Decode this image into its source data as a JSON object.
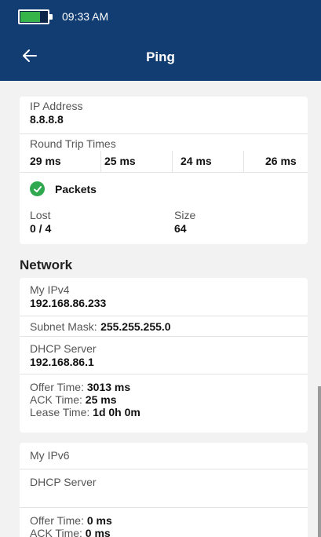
{
  "status_bar": {
    "time": "09:33 AM"
  },
  "header": {
    "title": "Ping"
  },
  "ping": {
    "ip_label": "IP Address",
    "ip_value": "8.8.8.8",
    "rtt_label": "Round Trip Times",
    "rtt": [
      "29 ms",
      "25 ms",
      "24 ms",
      "26 ms"
    ],
    "packets_label": "Packets",
    "lost_label": "Lost",
    "lost_value": "0 / 4",
    "size_label": "Size",
    "size_value": "64"
  },
  "network": {
    "section_title": "Network",
    "ipv4_label": "My IPv4",
    "ipv4_value": "192.168.86.233",
    "subnet_label": "Subnet Mask:",
    "subnet_value": "255.255.255.0",
    "dhcp_label": "DHCP Server",
    "dhcp_value": "192.168.86.1",
    "offer_label": "Offer Time:",
    "offer_value": "3013 ms",
    "ack_label": "ACK Time:",
    "ack_value": "25 ms",
    "lease_label": "Lease Time:",
    "lease_value": "1d 0h 0m",
    "ipv6_label": "My IPv6",
    "ipv6_dhcp_label": "DHCP Server",
    "ipv6_offer_label": "Offer Time:",
    "ipv6_offer_value": "0 ms",
    "ipv6_ack_label": "ACK Time:",
    "ipv6_ack_value": "0 ms"
  },
  "colors": {
    "appbar": "#123d72",
    "battery_fill": "#36b449",
    "check": "#2fa84f"
  },
  "icons": {
    "back": "arrow-left",
    "packets": "check-circle",
    "battery": "battery"
  }
}
